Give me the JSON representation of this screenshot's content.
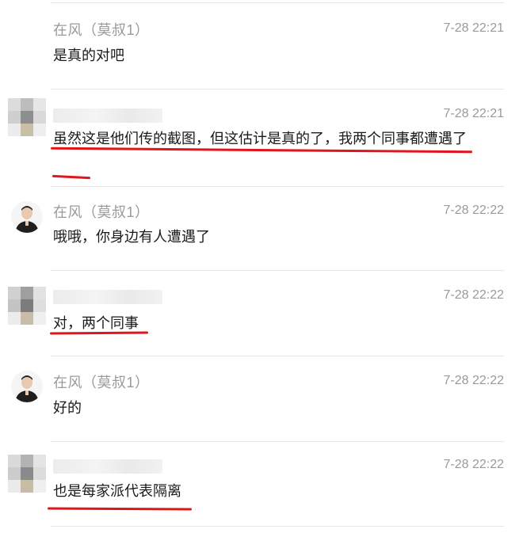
{
  "messages": [
    {
      "author": "在风（莫叔1）",
      "time": "7-28 22:21",
      "text": "是真的对吧"
    },
    {
      "author": "",
      "time": "7-28 22:21",
      "text": "虽然这是他们传的截图，但这估计是真的了，我两个同事都遭遇了"
    },
    {
      "author": "在风（莫叔1）",
      "time": "7-28 22:22",
      "text": "哦哦，你身边有人遭遇了"
    },
    {
      "author": "",
      "time": "7-28 22:22",
      "text": "对，两个同事"
    },
    {
      "author": "在风（莫叔1）",
      "time": "7-28 22:22",
      "text": "好的"
    },
    {
      "author": "",
      "time": "7-28 22:22",
      "text": "也是每家派代表隔离"
    }
  ],
  "colors": {
    "underline": "#e0161b",
    "meta_text": "#9a9a9a"
  },
  "icons": {
    "known_avatar": "person-avatar-icon",
    "blurred_avatar": "pixelated-avatar"
  }
}
